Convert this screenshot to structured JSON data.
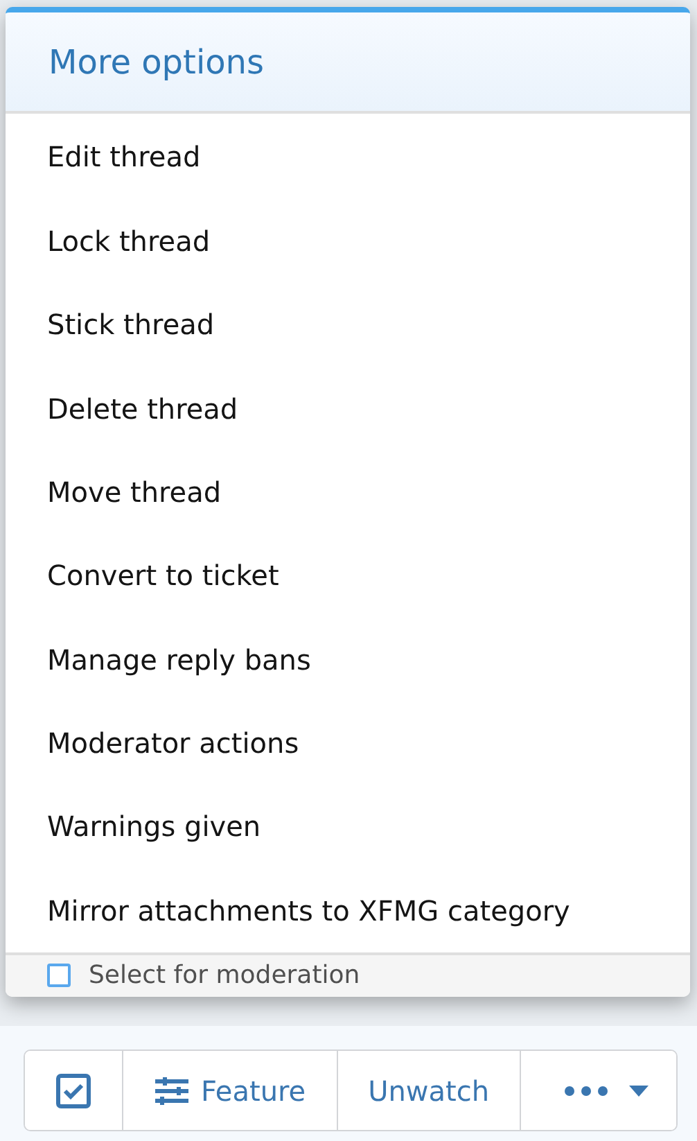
{
  "menu": {
    "title": "More options",
    "items": [
      {
        "label": "Edit thread"
      },
      {
        "label": "Lock thread"
      },
      {
        "label": "Stick thread"
      },
      {
        "label": "Delete thread"
      },
      {
        "label": "Move thread"
      },
      {
        "label": "Convert to ticket"
      },
      {
        "label": "Manage reply bans"
      },
      {
        "label": "Moderator actions"
      },
      {
        "label": "Warnings given"
      },
      {
        "label": "Mirror attachments to XFMG category"
      }
    ],
    "footer": {
      "label": "Select for moderation",
      "checked": false
    }
  },
  "button_bar": {
    "buttons": [
      {
        "kind": "select"
      },
      {
        "kind": "feature",
        "label": "Feature"
      },
      {
        "kind": "text",
        "label": "Unwatch"
      },
      {
        "kind": "more"
      }
    ]
  }
}
